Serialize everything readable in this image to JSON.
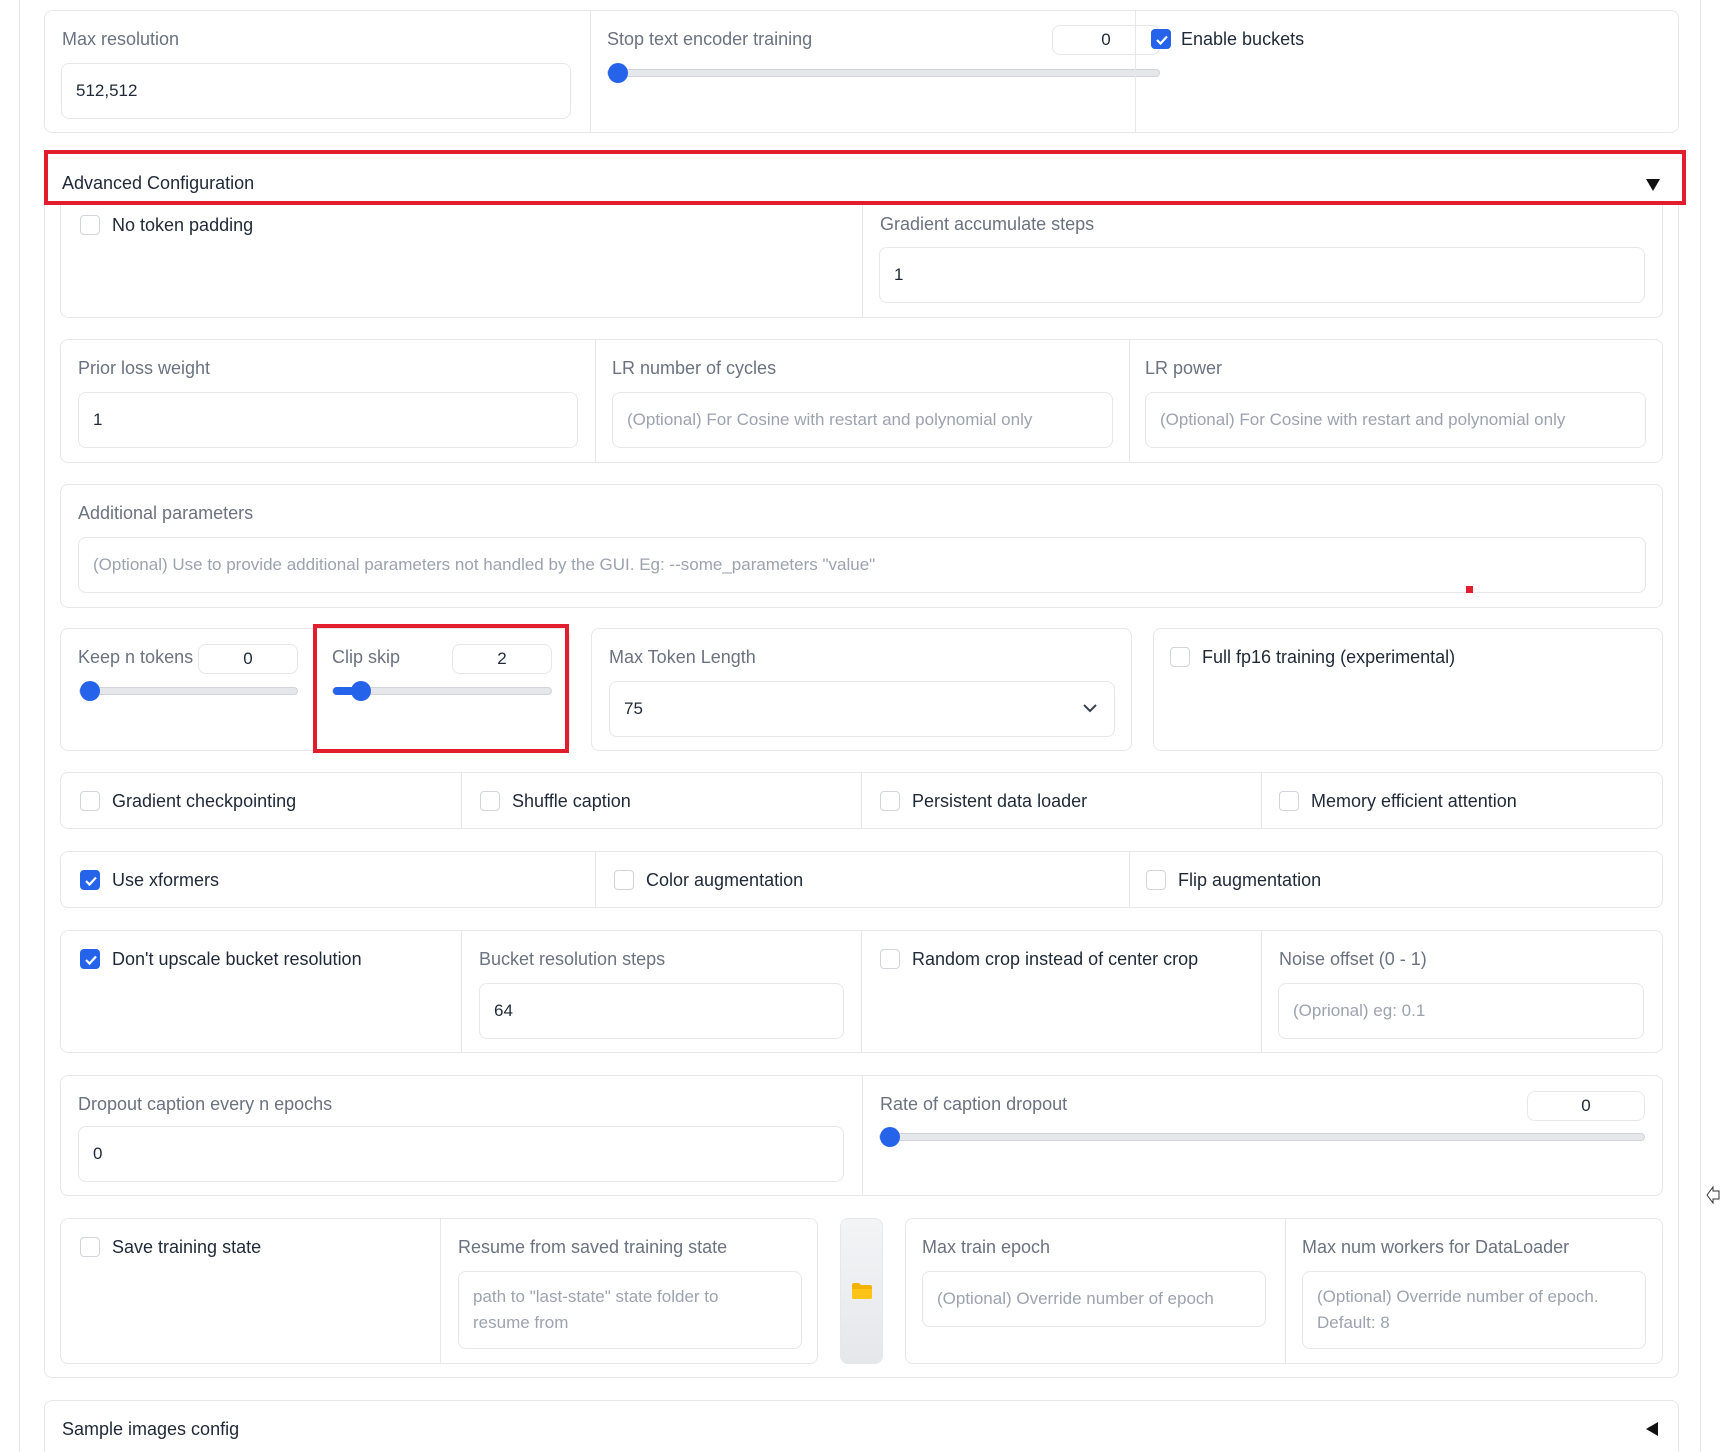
{
  "top_row": {
    "max_resolution": {
      "label": "Max resolution",
      "value": "512,512"
    },
    "stop_text_encoder": {
      "label": "Stop text encoder training",
      "value": "0",
      "fraction": 0
    },
    "enable_buckets": {
      "label": "Enable buckets",
      "checked": true
    }
  },
  "advanced": {
    "title": "Advanced Configuration",
    "toggle_icon": "triangle-down-icon",
    "no_token_padding": {
      "label": "No token padding",
      "checked": false
    },
    "gradient_accumulate": {
      "label": "Gradient accumulate steps",
      "value": "1"
    },
    "prior_loss_weight": {
      "label": "Prior loss weight",
      "value": "1"
    },
    "lr_cycles": {
      "label": "LR number of cycles",
      "placeholder": "(Optional) For Cosine with restart and polynomial only"
    },
    "lr_power": {
      "label": "LR power",
      "placeholder": "(Optional) For Cosine with restart and polynomial only"
    },
    "additional_params": {
      "label": "Additional parameters",
      "placeholder": "(Optional) Use to provide additional parameters not handled by the GUI. Eg: --some_parameters \"value\""
    },
    "keep_n_tokens": {
      "label": "Keep n tokens",
      "value": "0",
      "fraction": 0
    },
    "clip_skip": {
      "label": "Clip skip",
      "value": "2",
      "fraction": 0.1
    },
    "max_token_length": {
      "label": "Max Token Length",
      "value": "75"
    },
    "full_fp16": {
      "label": "Full fp16 training (experimental)",
      "checked": false
    },
    "row_checks_1": [
      {
        "label": "Gradient checkpointing",
        "checked": false
      },
      {
        "label": "Shuffle caption",
        "checked": false
      },
      {
        "label": "Persistent data loader",
        "checked": false
      },
      {
        "label": "Memory efficient attention",
        "checked": false
      }
    ],
    "row_checks_2": [
      {
        "label": "Use xformers",
        "checked": true
      },
      {
        "label": "Color augmentation",
        "checked": false
      },
      {
        "label": "Flip augmentation",
        "checked": false
      }
    ],
    "dont_upscale": {
      "label": "Don't upscale bucket resolution",
      "checked": true
    },
    "bucket_steps": {
      "label": "Bucket resolution steps",
      "value": "64"
    },
    "random_crop": {
      "label": "Random crop instead of center crop",
      "checked": false
    },
    "noise_offset": {
      "label": "Noise offset (0 - 1)",
      "placeholder": "(Oprional) eg: 0.1"
    },
    "dropout_every": {
      "label": "Dropout caption every n epochs",
      "value": "0"
    },
    "caption_dropout_rate": {
      "label": "Rate of caption dropout",
      "value": "0",
      "fraction": 0
    },
    "save_state": {
      "label": "Save training state",
      "checked": false
    },
    "resume_state": {
      "label": "Resume from saved training state",
      "placeholder_line1": "path to \"last-state\" state folder to",
      "placeholder_line2": "resume from"
    },
    "folder_button_icon": "folder-icon",
    "max_train_epoch": {
      "label": "Max train epoch",
      "placeholder": "(Optional) Override number of epoch"
    },
    "max_workers": {
      "label": "Max num workers for DataLoader",
      "placeholder_line1": "(Optional) Override number of epoch.",
      "placeholder_line2": "Default: 8"
    }
  },
  "sample_images": {
    "title": "Sample images config",
    "toggle_icon": "triangle-left-icon"
  },
  "colors": {
    "accent": "#2563eb",
    "highlight": "#e11d2e",
    "border": "#e5e7eb"
  }
}
